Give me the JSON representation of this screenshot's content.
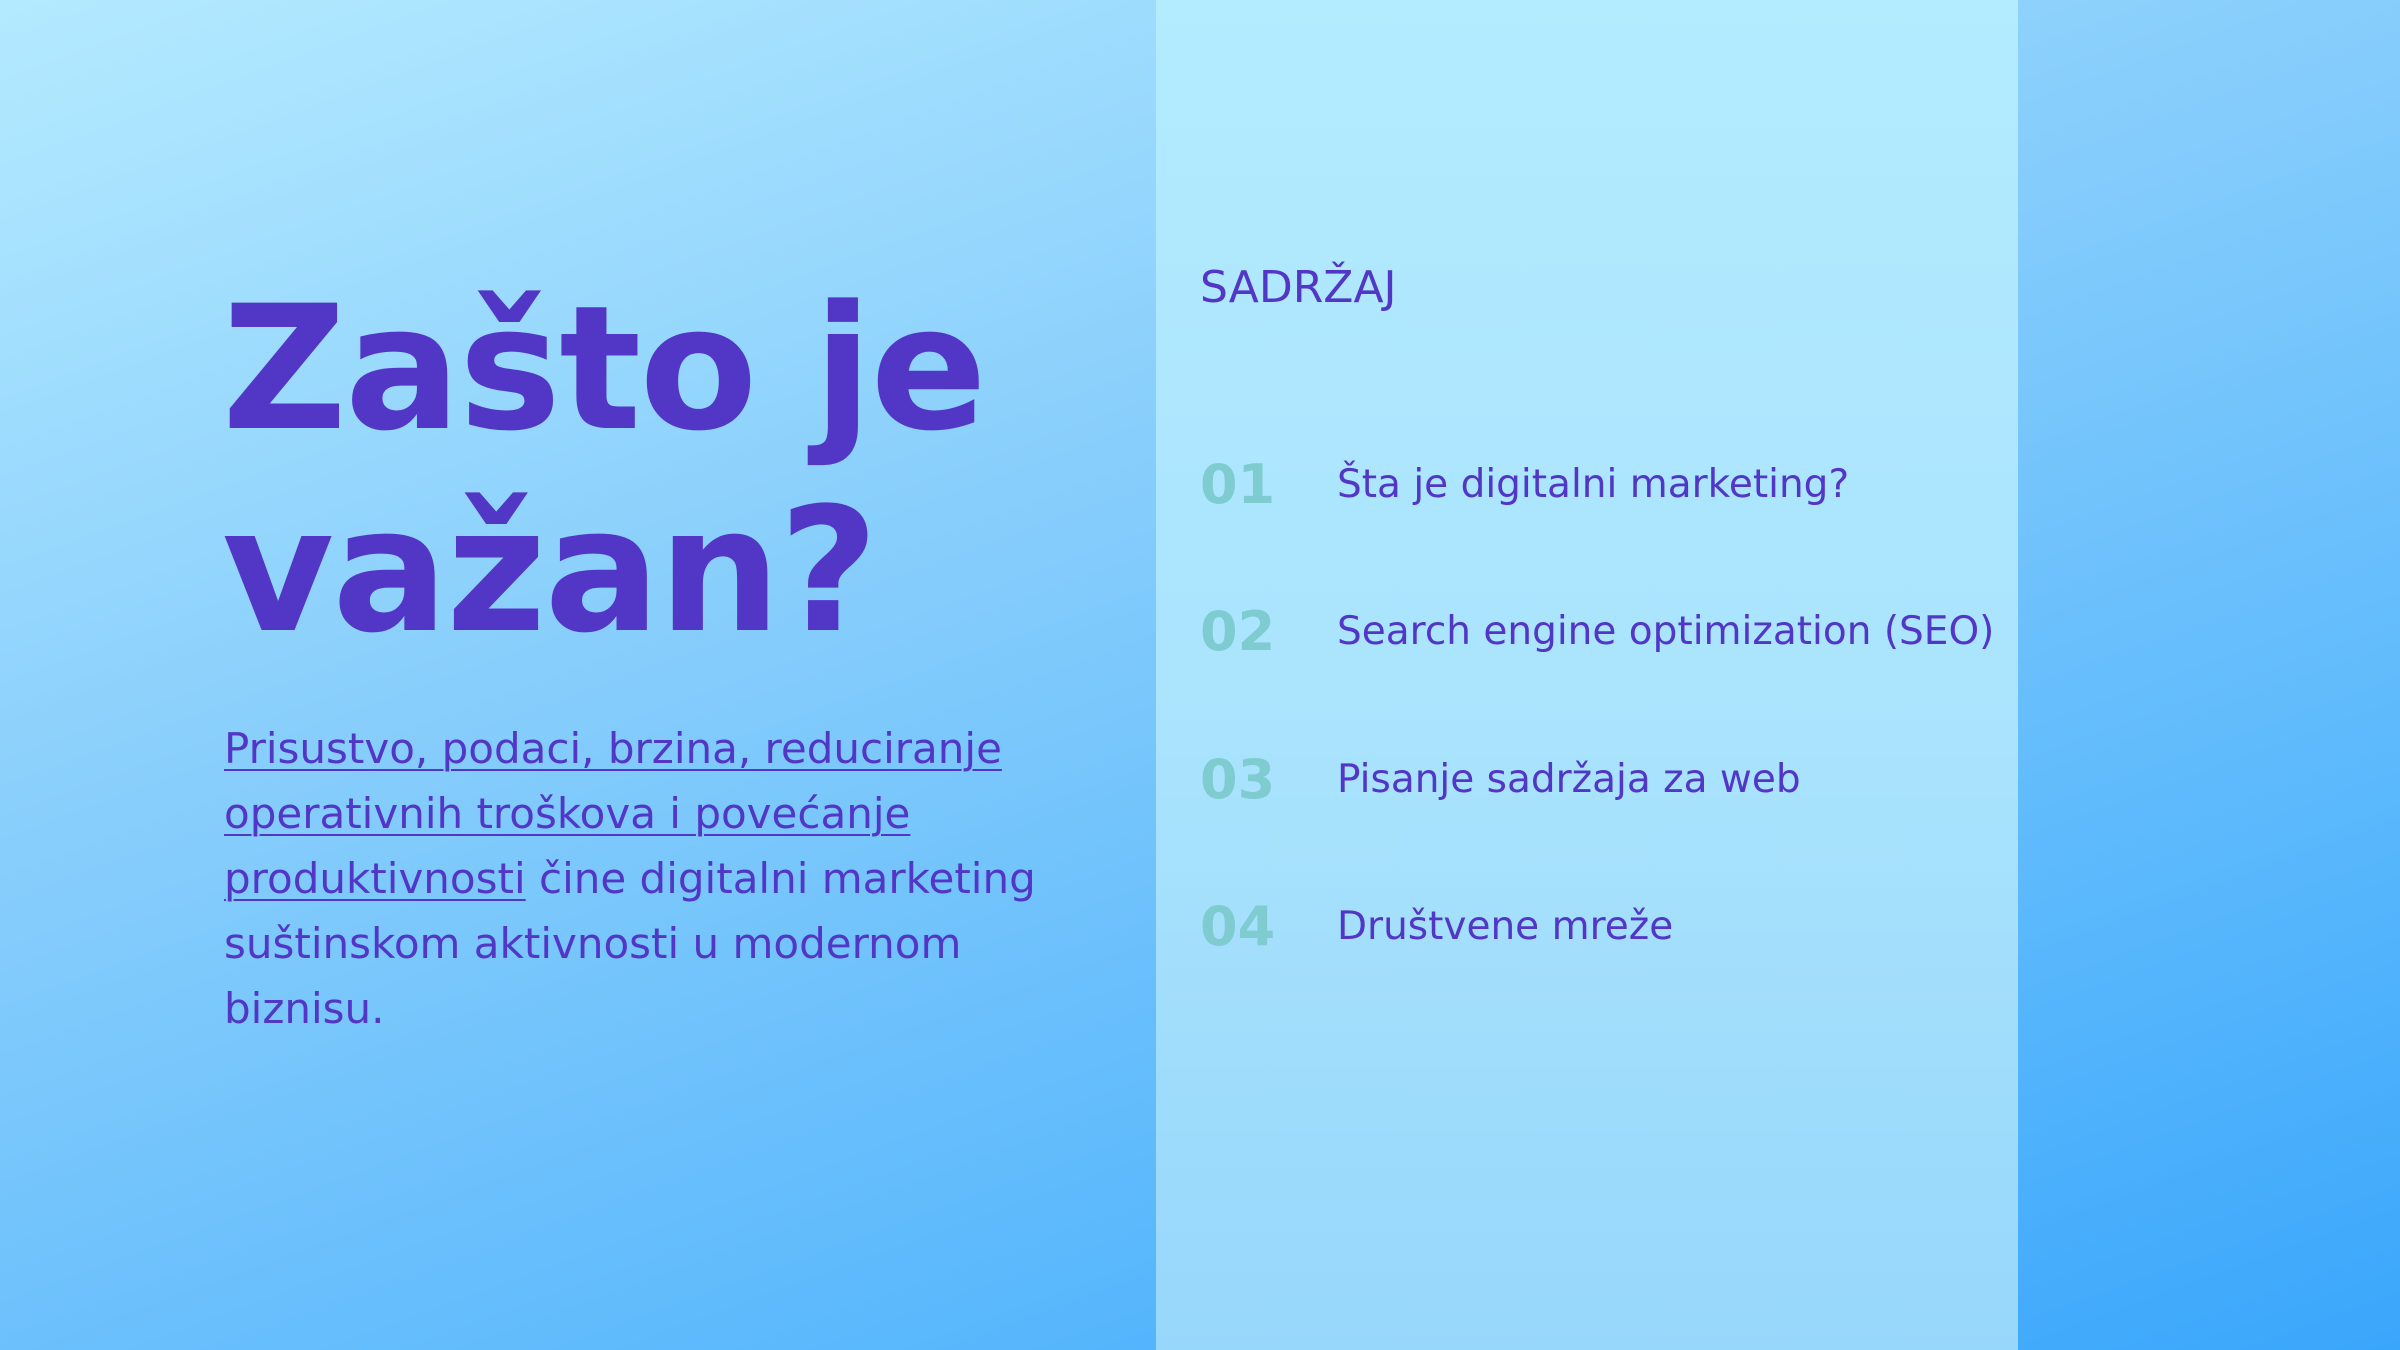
{
  "title": {
    "line1": "Zašto je",
    "line2": "važan?"
  },
  "paragraph": {
    "link_text": "Prisustvo, podaci, brzina, reduciranje operativnih troškova i povećanje produktivnosti",
    "rest_text": " čine digitalni marketing suštinskom aktivnosti u modernom biznisu."
  },
  "toc": {
    "heading": "SADRŽAJ",
    "items": [
      {
        "number": "01",
        "label": "Šta je digitalni marketing?"
      },
      {
        "number": "02",
        "label": "Search engine optimization (SEO)"
      },
      {
        "number": "03",
        "label": "Pisanje sadržaja za web"
      },
      {
        "number": "04",
        "label": "Društvene mreže"
      }
    ]
  },
  "colors": {
    "accent": "#5237c7",
    "number": "#7ecbd0",
    "panel": "#aee6fd"
  }
}
